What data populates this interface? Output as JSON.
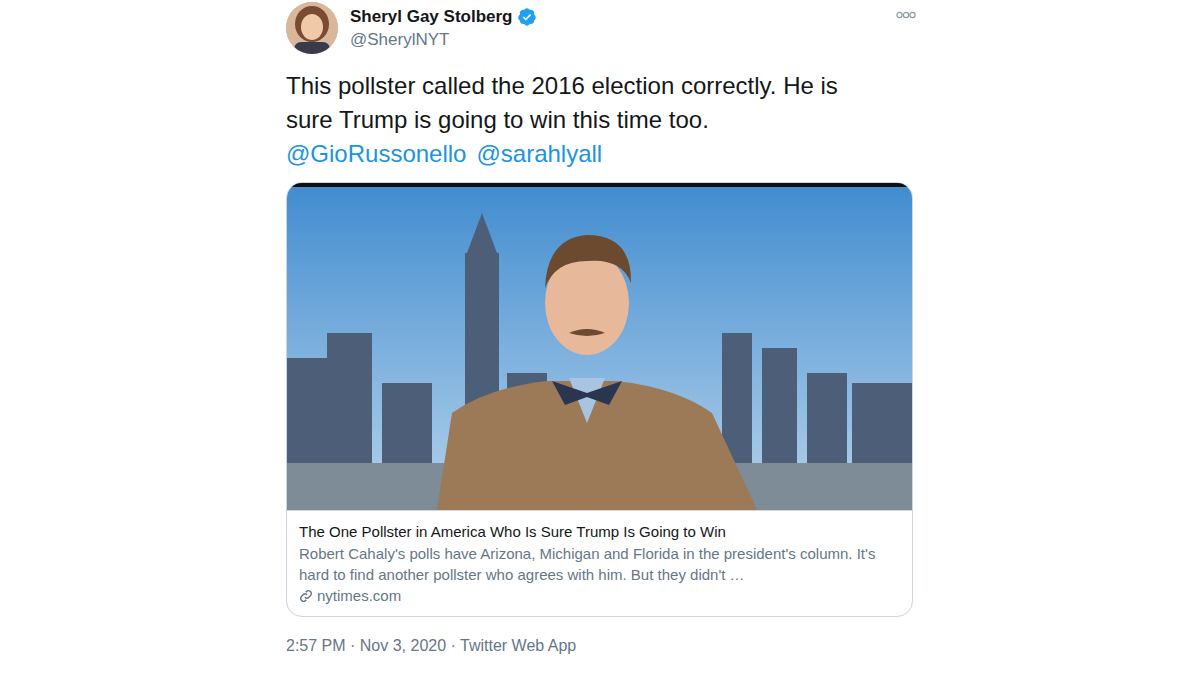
{
  "author": {
    "name": "Sheryl Gay Stolberg",
    "handle": "@SherylNYT",
    "verified": true
  },
  "text": "This pollster called the 2016 election correctly. He is sure Trump is going to win this time too.",
  "mentions": [
    "@GioRussonello",
    "@sarahlyall"
  ],
  "card": {
    "title": "The One Pollster in America Who Is Sure Trump Is Going to Win",
    "description": "Robert Cahaly's polls have Arizona, Michigan and Florida in the president's column. It's hard to find another pollster who agrees with him. But they didn't …",
    "domain": "nytimes.com"
  },
  "timestamp": "2:57 PM · Nov 3, 2020 · Twitter Web App"
}
